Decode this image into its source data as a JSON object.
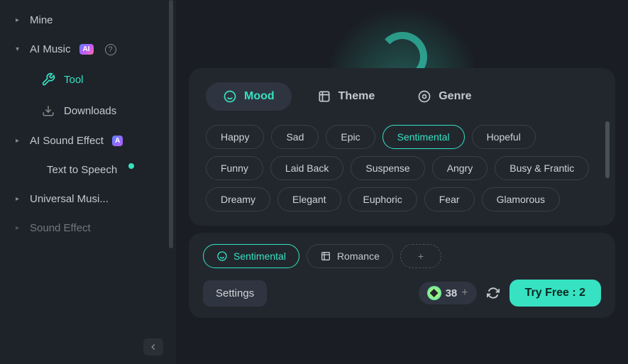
{
  "sidebar": {
    "items": [
      {
        "label": "Mine",
        "type": "top"
      },
      {
        "label": "AI Music",
        "type": "top",
        "expanded": true,
        "ai_badge": "AI"
      },
      {
        "label": "Tool",
        "type": "sub",
        "active": true,
        "icon": "tool"
      },
      {
        "label": "Downloads",
        "type": "sub",
        "icon": "download"
      },
      {
        "label": "AI Sound Effect",
        "type": "top",
        "badge": "A"
      },
      {
        "label": "Text to Speech",
        "type": "sub-flat",
        "dot": true
      },
      {
        "label": "Universal Musi...",
        "type": "top"
      },
      {
        "label": "Sound Effect",
        "type": "top",
        "faded": true
      }
    ]
  },
  "categories": {
    "tabs": [
      {
        "label": "Mood",
        "active": true
      },
      {
        "label": "Theme",
        "active": false
      },
      {
        "label": "Genre",
        "active": false
      }
    ]
  },
  "moods": [
    {
      "label": "Happy"
    },
    {
      "label": "Sad"
    },
    {
      "label": "Epic"
    },
    {
      "label": "Sentimental",
      "selected": true
    },
    {
      "label": "Hopeful"
    },
    {
      "label": "Funny"
    },
    {
      "label": "Laid Back"
    },
    {
      "label": "Suspense"
    },
    {
      "label": "Angry"
    },
    {
      "label": "Busy & Frantic"
    },
    {
      "label": "Dreamy"
    },
    {
      "label": "Elegant"
    },
    {
      "label": "Euphoric"
    },
    {
      "label": "Fear"
    },
    {
      "label": "Glamorous"
    }
  ],
  "selected_chips": [
    {
      "type": "mood",
      "label": "Sentimental"
    },
    {
      "type": "theme",
      "label": "Romance"
    }
  ],
  "settings_label": "Settings",
  "credits": {
    "count": "38"
  },
  "try_free": {
    "label": "Try Free : 2"
  }
}
